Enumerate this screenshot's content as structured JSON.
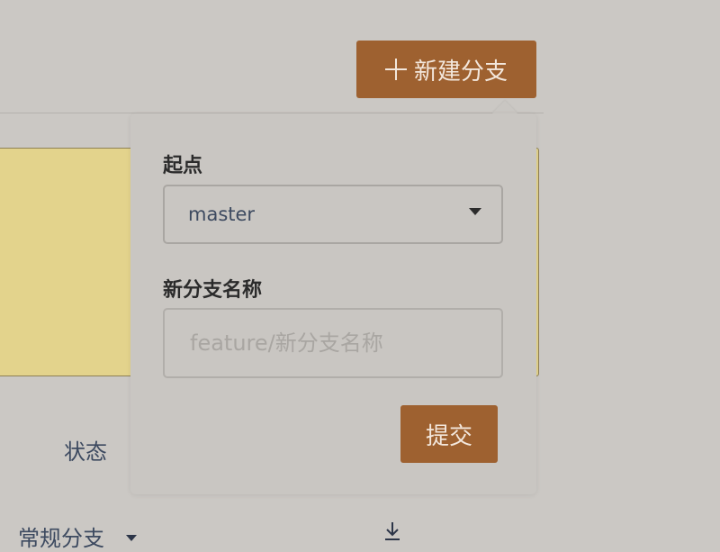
{
  "toolbar": {
    "new_branch_label": "新建分支"
  },
  "popover": {
    "start_label": "起点",
    "start_value": "master",
    "name_label": "新分支名称",
    "name_placeholder": "feature/新分支名称",
    "name_value": "",
    "submit_label": "提交"
  },
  "background": {
    "status_label": "状态",
    "branch_type_label": "常规分支"
  },
  "colors": {
    "accent": "#9e6130",
    "page_bg": "#cbc8c4",
    "notice_bg": "#e3d38c"
  }
}
